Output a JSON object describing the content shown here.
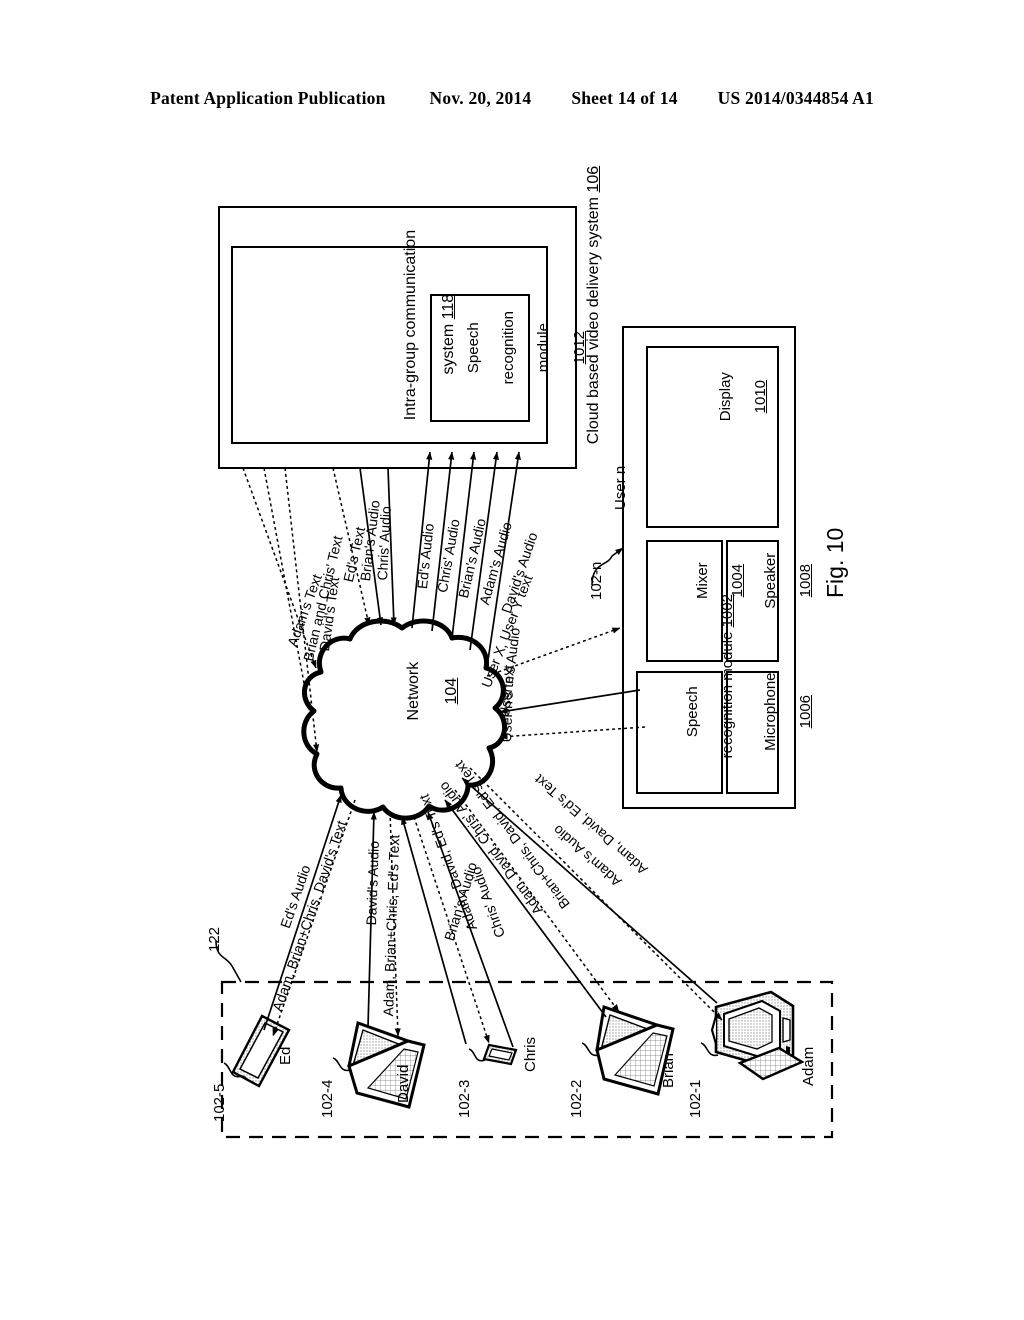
{
  "header": {
    "publication": "Patent Application Publication",
    "date": "Nov. 20, 2014",
    "sheet": "Sheet 14 of 14",
    "number": "US 2014/0344854 A1"
  },
  "figure": {
    "caption": "Fig. 10"
  },
  "cloud_system": {
    "outer_label": "Cloud based video delivery system",
    "outer_ref": "106",
    "inner_label_line1": "Intra-group communication",
    "inner_label_line2": "system",
    "inner_ref": "118",
    "module": {
      "line1": "Speech",
      "line2": "recognition",
      "line3": "module",
      "ref": "1012"
    }
  },
  "network": {
    "label": "Network",
    "ref": "104"
  },
  "user_n": {
    "title": "User n",
    "device_ref": "102-n",
    "blocks": [
      {
        "name": "display",
        "line1": "Display",
        "line2": "",
        "ref": "1010"
      },
      {
        "name": "mixer",
        "line1": "Mixer",
        "line2": "",
        "ref": "1004"
      },
      {
        "name": "speaker",
        "line1": "Speaker",
        "line2": "",
        "ref": "1008"
      },
      {
        "name": "speech",
        "line1": "Speech",
        "line2": "recognition module",
        "ref": "1002"
      },
      {
        "name": "microphone",
        "line1": "Microphone",
        "line2": "",
        "ref": "1006"
      }
    ]
  },
  "group": {
    "ref": "122"
  },
  "devices": [
    {
      "name": "Ed",
      "ref": "102-5",
      "type": "tablet"
    },
    {
      "name": "David",
      "ref": "102-4",
      "type": "laptop"
    },
    {
      "name": "Chris",
      "ref": "102-3",
      "type": "phone"
    },
    {
      "name": "Brian",
      "ref": "102-2",
      "type": "laptop"
    },
    {
      "name": "Adam",
      "ref": "102-1",
      "type": "desktop"
    }
  ],
  "uplink_labels_text": [
    "Adam's Text",
    "Brian and Chris' Text",
    "David's Text",
    "Ed's Text"
  ],
  "uplink_labels_audio_left": [
    "Brian's Audio",
    "Chris' Audio"
  ],
  "uplink_labels_audio_right": [
    "Ed's Audio",
    "Chris' Audio",
    "Brian's Audio",
    "Adam's Audio",
    "David's Audio"
  ],
  "user_n_links": [
    "User X, User Y text",
    "User n's Audio",
    "User n's text"
  ],
  "device_links": [
    "Ed's Audio",
    "Adam, Brian+Chris, David's Text",
    "David's Audio",
    "Adam, Brian+Chris, Ed's Text",
    "Brian's Audio",
    "Adam, David, Ed's Text",
    "Chris' Audio",
    "Adam, David, Chris' Audio",
    "Brian+Chris, David, Ed's Text",
    "Adam's Audio",
    "Brian's Audio",
    "Adam, David, Ed's Text"
  ]
}
